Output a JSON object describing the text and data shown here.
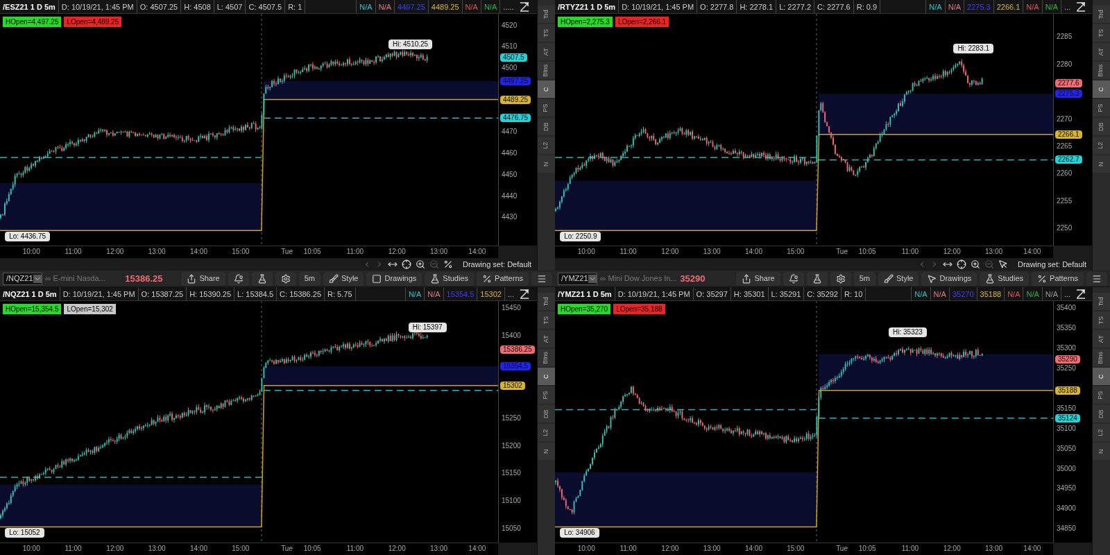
{
  "panels": [
    {
      "header": {
        "title": "/ESZ21 1 D 5m",
        "fields": [
          "D: 10/19/21, 1:45 PM",
          "O: 4507.25",
          "H: 4508",
          "L: 4507",
          "C: 4507.5",
          "R: 1"
        ],
        "studies": [
          {
            "text": "N/A",
            "color": "#2ec4c9"
          },
          {
            "text": "N/A",
            "color": "#e07a86"
          },
          {
            "text": "4497.25",
            "color": "#3a3aff"
          },
          {
            "text": "4489.25",
            "color": "#d8b936"
          },
          {
            "text": "N/A",
            "color": "#e0505a"
          },
          {
            "text": "N/A",
            "color": "#2fb34a"
          }
        ],
        "more": "....."
      },
      "open_labels": [
        {
          "text": "HOpen=4,497.25",
          "color": "#22dd22"
        },
        {
          "text": "LOpen=4,489.25",
          "color": "#ee2222"
        }
      ],
      "price_ticks": [
        "4520",
        "4510",
        "4500",
        "4470",
        "4460",
        "4450",
        "4440",
        "4430"
      ],
      "badges": [
        {
          "text": "4507.5",
          "color": "#22d3d8"
        },
        {
          "text": "4497.25",
          "color": "#2222ee"
        },
        {
          "text": "4489.25",
          "color": "#d8b52a"
        },
        {
          "text": "4476.75",
          "color": "#22d3d8"
        }
      ],
      "hi": "Hi: 4510.25",
      "lo": "Lo: 4436.75",
      "time_ticks": [
        "10:00",
        "11:00",
        "12:00",
        "13:00",
        "14:00",
        "15:00",
        "Tue",
        "10:05",
        "11:00",
        "12:00",
        "13:00",
        "14:00"
      ],
      "footer": "Drawing set: Default",
      "side_tabs": [
        {
          "label": "Trd",
          "selected": false
        },
        {
          "label": "TS",
          "selected": false
        },
        {
          "label": "AT",
          "selected": false
        },
        {
          "label": "Btns",
          "selected": false
        },
        {
          "label": "C",
          "selected": true
        },
        {
          "label": "PS",
          "selected": false
        },
        {
          "label": "DB",
          "selected": false
        },
        {
          "label": "L2",
          "selected": false
        },
        {
          "label": "N",
          "selected": false
        }
      ]
    },
    {
      "header": {
        "title": "/RTYZ21 1 D 5m",
        "fields": [
          "D: 10/19/21, 1:45 PM",
          "O: 2277.8",
          "H: 2278.1",
          "L: 2277.2",
          "C: 2277.6",
          "R: 0.9"
        ],
        "studies": [
          {
            "text": "N/A",
            "color": "#2ec4c9"
          },
          {
            "text": "N/A",
            "color": "#e07a86"
          },
          {
            "text": "2275.3",
            "color": "#3a3aff"
          },
          {
            "text": "2266.1",
            "color": "#d8b936"
          },
          {
            "text": "N/A",
            "color": "#e0505a"
          },
          {
            "text": "N/A",
            "color": "#2fb34a"
          }
        ],
        "more": "..."
      },
      "open_labels": [
        {
          "text": "HOpen=2,275.3",
          "color": "#22dd22"
        },
        {
          "text": "LOpen=2,266.1",
          "color": "#ee2222"
        }
      ],
      "price_ticks": [
        "2285",
        "2280",
        "2270",
        "2265",
        "2260",
        "2255",
        "2250"
      ],
      "badges": [
        {
          "text": "2277.6",
          "color": "#f06b74"
        },
        {
          "text": "2275.3",
          "color": "#2222ee"
        },
        {
          "text": "2266.1",
          "color": "#d8b52a"
        },
        {
          "text": "2262.7",
          "color": "#22d3d8"
        }
      ],
      "hi": "Hi: 2283.1",
      "lo": "Lo: 2250.9",
      "time_ticks": [
        "10:00",
        "11:00",
        "12:00",
        "13:00",
        "14:00",
        "15:00",
        "Tue",
        "10:05",
        "11:00",
        "12:00",
        "13:00",
        "14:00"
      ],
      "footer": "Drawing set: Default",
      "side_tabs": [
        {
          "label": "Trd",
          "selected": false
        },
        {
          "label": "TS",
          "selected": false
        },
        {
          "label": "AT",
          "selected": false
        },
        {
          "label": "Btns",
          "selected": false
        },
        {
          "label": "C",
          "selected": true
        },
        {
          "label": "PS",
          "selected": false
        },
        {
          "label": "DB",
          "selected": false
        },
        {
          "label": "L2",
          "selected": false
        },
        {
          "label": "N",
          "selected": false
        }
      ]
    },
    {
      "toolbar": {
        "symbol": "/NQZ21",
        "description": "E-mini Nasda...",
        "price": "15386.25",
        "buttons": [
          {
            "kind": "share",
            "label": "Share"
          },
          {
            "kind": "alert"
          },
          {
            "kind": "flask"
          },
          {
            "kind": "gear"
          },
          {
            "kind": "text",
            "label": "5m"
          },
          {
            "kind": "style",
            "label": "Style"
          },
          {
            "kind": "drawings",
            "label": "Drawings"
          },
          {
            "kind": "studies",
            "label": "Studies"
          },
          {
            "kind": "patterns",
            "label": "Patterns"
          },
          {
            "kind": "menu"
          }
        ]
      },
      "header": {
        "title": "/NQZ21 1 D 5m",
        "fields": [
          "D: 10/19/21, 1:45 PM",
          "O: 15387.25",
          "H: 15390.25",
          "L: 15384.5",
          "C: 15386.25",
          "R: 5.75"
        ],
        "studies": [
          {
            "text": "N/A",
            "color": "#2ec4c9"
          },
          {
            "text": "N/A",
            "color": "#e07a86"
          },
          {
            "text": "15354.5",
            "color": "#3a3aff"
          },
          {
            "text": "15302",
            "color": "#d8b936"
          }
        ],
        "more": "..."
      },
      "open_labels": [
        {
          "text": "HOpen=15,354.5",
          "color": "#22dd22"
        },
        {
          "text": "LOpen=15,302",
          "color": "#c8c8c8"
        }
      ],
      "price_ticks": [
        "15450",
        "15400",
        "15250",
        "15200",
        "15150",
        "15100",
        "15050"
      ],
      "badges": [
        {
          "text": "15386.25",
          "color": "#f06b74"
        },
        {
          "text": "15354.5",
          "color": "#2222ee"
        },
        {
          "text": "15302",
          "color": "#d8b52a"
        }
      ],
      "hi": "Hi: 15397",
      "lo": "Lo: 15052",
      "time_ticks": [
        "10:00",
        "11:00",
        "12:00",
        "13:00",
        "14:00",
        "15:00",
        "Tue",
        "10:05",
        "11:00",
        "12:00",
        "13:00",
        "14:00"
      ],
      "side_tabs": [
        {
          "label": "Trd",
          "selected": false
        },
        {
          "label": "TS",
          "selected": false
        },
        {
          "label": "AT",
          "selected": false
        },
        {
          "label": "Btns",
          "selected": false
        },
        {
          "label": "C",
          "selected": true
        },
        {
          "label": "PS",
          "selected": false
        },
        {
          "label": "DB",
          "selected": false
        },
        {
          "label": "L2",
          "selected": false
        },
        {
          "label": "N",
          "selected": false
        }
      ]
    },
    {
      "toolbar": {
        "symbol": "/YMZ21",
        "description": "Mini Dow Jones In...",
        "price": "35290",
        "buttons": [
          {
            "kind": "share",
            "label": "Share"
          },
          {
            "kind": "alert"
          },
          {
            "kind": "flask"
          },
          {
            "kind": "gear"
          },
          {
            "kind": "text",
            "label": "5m"
          },
          {
            "kind": "style",
            "label": "Style"
          },
          {
            "kind": "pointer",
            "label": "Drawings"
          },
          {
            "kind": "studies",
            "label": "Studies"
          },
          {
            "kind": "patterns",
            "label": "Patterns"
          },
          {
            "kind": "menu"
          }
        ]
      },
      "header": {
        "title": "/YMZ21 1 D 5m",
        "fields": [
          "D: 10/19/21, 1:45 PM",
          "O: 35297",
          "H: 35301",
          "L: 35291",
          "C: 35292",
          "R: 10"
        ],
        "studies": [
          {
            "text": "N/A",
            "color": "#2ec4c9"
          },
          {
            "text": "N/A",
            "color": "#e07a86"
          },
          {
            "text": "35270",
            "color": "#3a3aff"
          },
          {
            "text": "35188",
            "color": "#d8b936"
          },
          {
            "text": "N/A",
            "color": "#e0505a"
          },
          {
            "text": "N/A",
            "color": "#2fb34a"
          },
          {
            "text": "N/A",
            "color": "#9a9a9a"
          }
        ],
        "more": "..."
      },
      "open_labels": [
        {
          "text": "HOpen=35,270",
          "color": "#22dd22"
        },
        {
          "text": "LOpen=35,188",
          "color": "#ee2222"
        }
      ],
      "price_ticks": [
        "35400",
        "35350",
        "35300",
        "35250",
        "35150",
        "35100",
        "35050",
        "35000",
        "34950",
        "34900",
        "34850"
      ],
      "badges": [
        {
          "text": "35290",
          "color": "#f06b74"
        },
        {
          "text": "35188",
          "color": "#d8b52a"
        },
        {
          "text": "35124",
          "color": "#22d3d8"
        }
      ],
      "hi": "Hi: 35323",
      "lo": "Lo: 34906",
      "time_ticks": [
        "10:00",
        "11:00",
        "12:00",
        "13:00",
        "14:00",
        "15:00",
        "Tue",
        "10:05",
        "11:00",
        "12:00",
        "13:00",
        "14:00"
      ],
      "side_tabs": [
        {
          "label": "Trd",
          "selected": false
        },
        {
          "label": "TS",
          "selected": false
        },
        {
          "label": "AT",
          "selected": false
        },
        {
          "label": "Btns",
          "selected": false
        },
        {
          "label": "C",
          "selected": true
        },
        {
          "label": "PS",
          "selected": false
        },
        {
          "label": "DB",
          "selected": false
        },
        {
          "label": "L2",
          "selected": false
        },
        {
          "label": "N",
          "selected": false
        }
      ]
    }
  ]
}
